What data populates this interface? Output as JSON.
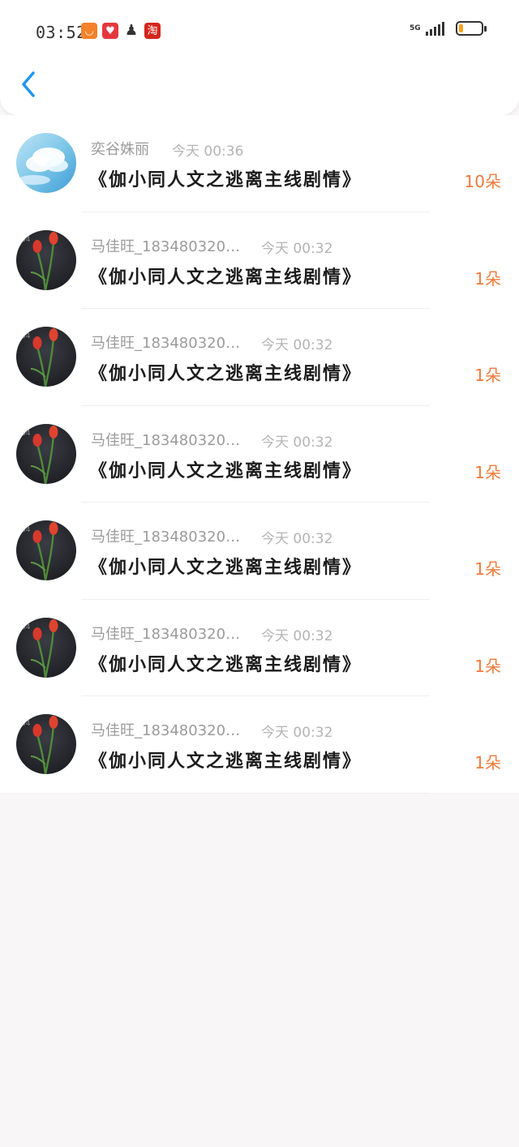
{
  "status_bar": {
    "time": "03:52",
    "notifications": [
      "taobao-icon",
      "heart-app-icon",
      "qq-icon",
      "tao-app-icon"
    ],
    "network": "5G",
    "battery_level": 0.2
  },
  "header": {
    "back_icon": "chevron-left-icon"
  },
  "messages": [
    {
      "avatar": "sky-clouds",
      "name": "奕谷姝丽",
      "time": "今天 00:36",
      "title": "《伽小同人文之逃离主线剧情》",
      "count": "10朵"
    },
    {
      "avatar": "red-tulips",
      "name": "马佳旺_183480320…",
      "time": "今天 00:32",
      "title": "《伽小同人文之逃离主线剧情》",
      "count": "1朵"
    },
    {
      "avatar": "red-tulips",
      "name": "马佳旺_183480320…",
      "time": "今天 00:32",
      "title": "《伽小同人文之逃离主线剧情》",
      "count": "1朵"
    },
    {
      "avatar": "red-tulips",
      "name": "马佳旺_183480320…",
      "time": "今天 00:32",
      "title": "《伽小同人文之逃离主线剧情》",
      "count": "1朵"
    },
    {
      "avatar": "red-tulips",
      "name": "马佳旺_183480320…",
      "time": "今天 00:32",
      "title": "《伽小同人文之逃离主线剧情》",
      "count": "1朵"
    },
    {
      "avatar": "red-tulips",
      "name": "马佳旺_183480320…",
      "time": "今天 00:32",
      "title": "《伽小同人文之逃离主线剧情》",
      "count": "1朵"
    },
    {
      "avatar": "red-tulips",
      "name": "马佳旺_183480320…",
      "time": "今天 00:32",
      "title": "《伽小同人文之逃离主线剧情》",
      "count": "1朵"
    }
  ],
  "colors": {
    "accent": "#2196f3",
    "count": "#f07a3a",
    "meta": "#9b9b9b",
    "title": "#1c1c1c"
  }
}
